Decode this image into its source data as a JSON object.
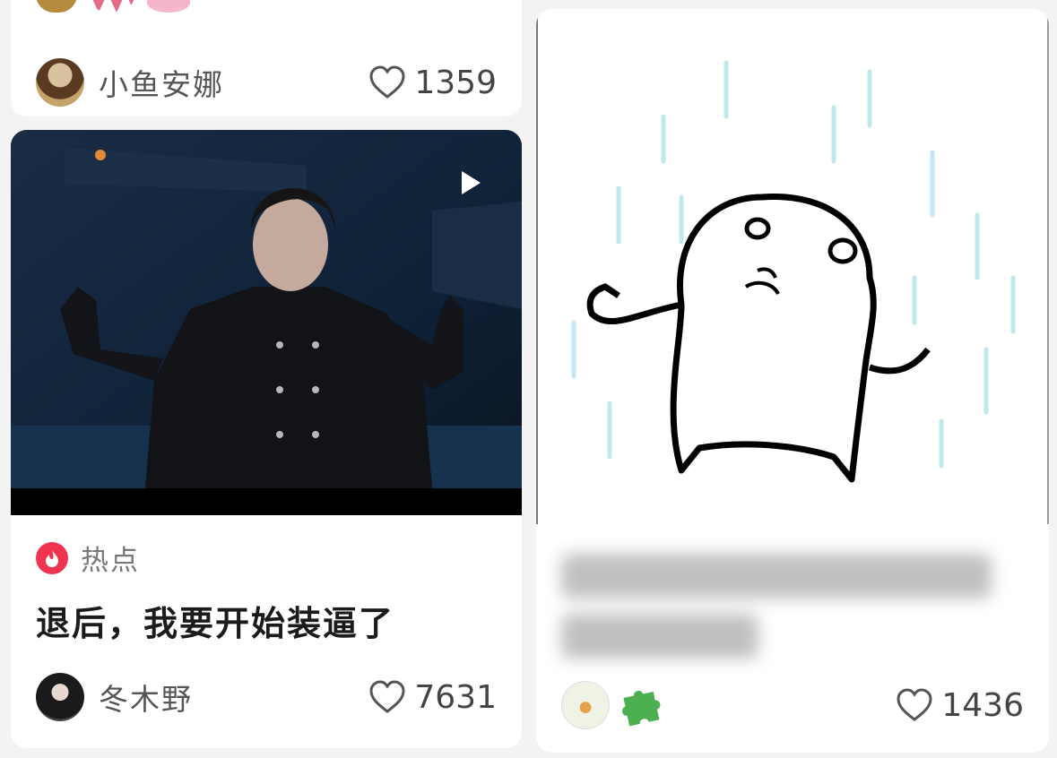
{
  "cards": {
    "card1": {
      "author": "小鱼安娜",
      "likes": "1359"
    },
    "card2": {
      "tag": "热点",
      "title": "退后，我要开始装逼了",
      "author": "冬木野",
      "likes": "7631"
    },
    "card3": {
      "likes": "1436"
    }
  },
  "icons": {
    "like": "heart-outline-icon",
    "hot": "fire-icon",
    "play": "play-icon",
    "puzzle": "puzzle-icon"
  },
  "colors": {
    "hot_badge": "#f0344f",
    "puzzle_green": "#4caf50",
    "rain": "#bfe9ef"
  }
}
